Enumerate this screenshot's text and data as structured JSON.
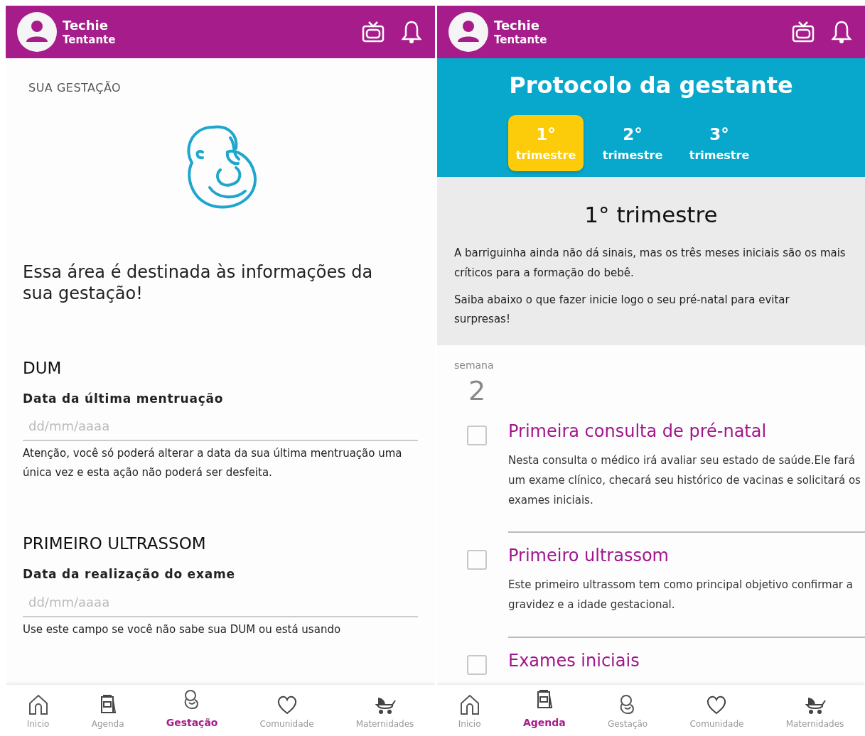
{
  "screens": [
    {
      "kind": "pregnancy",
      "header": {
        "name": "Techie",
        "status": "Tentante"
      },
      "section_label": "SUA GESTAÇÃO",
      "intro": "Essa área é destinada às informações da sua gestação!",
      "fields": [
        {
          "heading": "DUM",
          "label": "Data da última mentruação",
          "placeholder": "dd/mm/aaaa",
          "note": "Atenção, você só poderá alterar a data da sua última mentruação uma única vez e esta ação não poderá ser desfeita."
        },
        {
          "heading": "PRIMEIRO ULTRASSOM",
          "label": "Data da realização do exame",
          "placeholder": "dd/mm/aaaa",
          "note": "Use este campo se você não sabe sua DUM ou está usando"
        }
      ],
      "bottom_nav": [
        {
          "label": "Inicio",
          "selected": false
        },
        {
          "label": "Agenda",
          "selected": false
        },
        {
          "label": "Gestação",
          "selected": true
        },
        {
          "label": "Comunidade",
          "selected": false
        },
        {
          "label": "Maternidades",
          "selected": false
        }
      ]
    },
    {
      "kind": "protocol",
      "header": {
        "name": "Techie",
        "status": "Tentante"
      },
      "title": "Protocolo da gestante",
      "trimester_tabs": [
        {
          "number": "1°",
          "label": "trimestre",
          "selected": true
        },
        {
          "number": "2°",
          "label": "trimestre",
          "selected": false
        },
        {
          "number": "3°",
          "label": "trimestre",
          "selected": false
        }
      ],
      "section_title": "1° trimestre",
      "paragraphs": [
        "A barriguinha ainda não dá sinais, mas os três meses iniciais são os mais críticos para a formação do bebê.",
        "Saiba abaixo o que fazer inicie logo o seu pré-natal para evitar surpresas!"
      ],
      "week_label": "semana",
      "week_number": "2",
      "tasks": [
        {
          "title": "Primeira consulta de pré-natal",
          "description": "Nesta consulta o médico irá avaliar seu estado de saúde.Ele fará um exame clínico, checará seu histórico de vacinas e solicitará os exames iniciais.",
          "checked": false
        },
        {
          "title": "Primeiro ultrassom",
          "description": "Este primeiro ultrassom tem como principal objetivo confirmar a gravidez e a idade gestacional.",
          "checked": false
        },
        {
          "title": "Exames iniciais",
          "checked": false
        }
      ],
      "bottom_nav": [
        {
          "label": "Inicio",
          "selected": false
        },
        {
          "label": "Agenda",
          "selected": true
        },
        {
          "label": "Gestação",
          "selected": false
        },
        {
          "label": "Comunidade",
          "selected": false
        },
        {
          "label": "Maternidades",
          "selected": false
        }
      ]
    }
  ]
}
